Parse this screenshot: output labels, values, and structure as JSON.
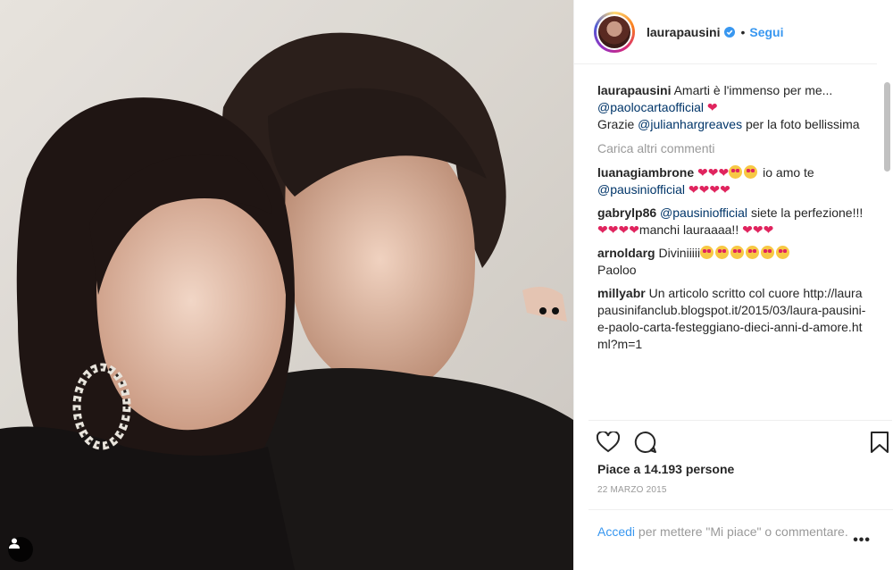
{
  "post": {
    "username": "laurapausini",
    "follow_label": "Segui",
    "separator": "•"
  },
  "comments": {
    "caption": {
      "user": "laurapausini",
      "text_before": "Amarti è l'immenso per me...",
      "mention1": "@paolocartaofficial",
      "text_mid": "Grazie",
      "mention2": "@julianhargreaves",
      "text_after": "per la foto bellissima"
    },
    "load_more": "Carica altri commenti",
    "items": [
      {
        "user": "luanagiambrone",
        "text1": "io amo te",
        "mention": "@pausiniofficial"
      },
      {
        "user": "gabrylp86",
        "mention": "@pausiniofficial",
        "text1": "siete la perfezione!!!",
        "text2": "manchi lauraaaa!!"
      },
      {
        "user": "arnoldarg",
        "text1": "Diviniiiii",
        "text2": "Paoloo"
      },
      {
        "user": "millyabr",
        "text1": "Un articolo scritto col cuore http://laurapausinifanclub.blogspot.it/2015/03/laura-pausini-e-paolo-carta-festeggiano-dieci-anni-d-amore.html?m=1"
      }
    ]
  },
  "actions": {
    "like_icon": "heart-outline-icon",
    "comment_icon": "comment-icon",
    "save_icon": "bookmark-icon"
  },
  "likes": "Piace a 14.193 persone",
  "date": "22 MARZO 2015",
  "login": {
    "link": "Accedi",
    "text": "per mettere \"Mi piace\" o commentare.",
    "more": "•••"
  },
  "colors": {
    "link_blue": "#3897f0",
    "mention_blue": "#003569",
    "heart_red": "#e0245e"
  }
}
